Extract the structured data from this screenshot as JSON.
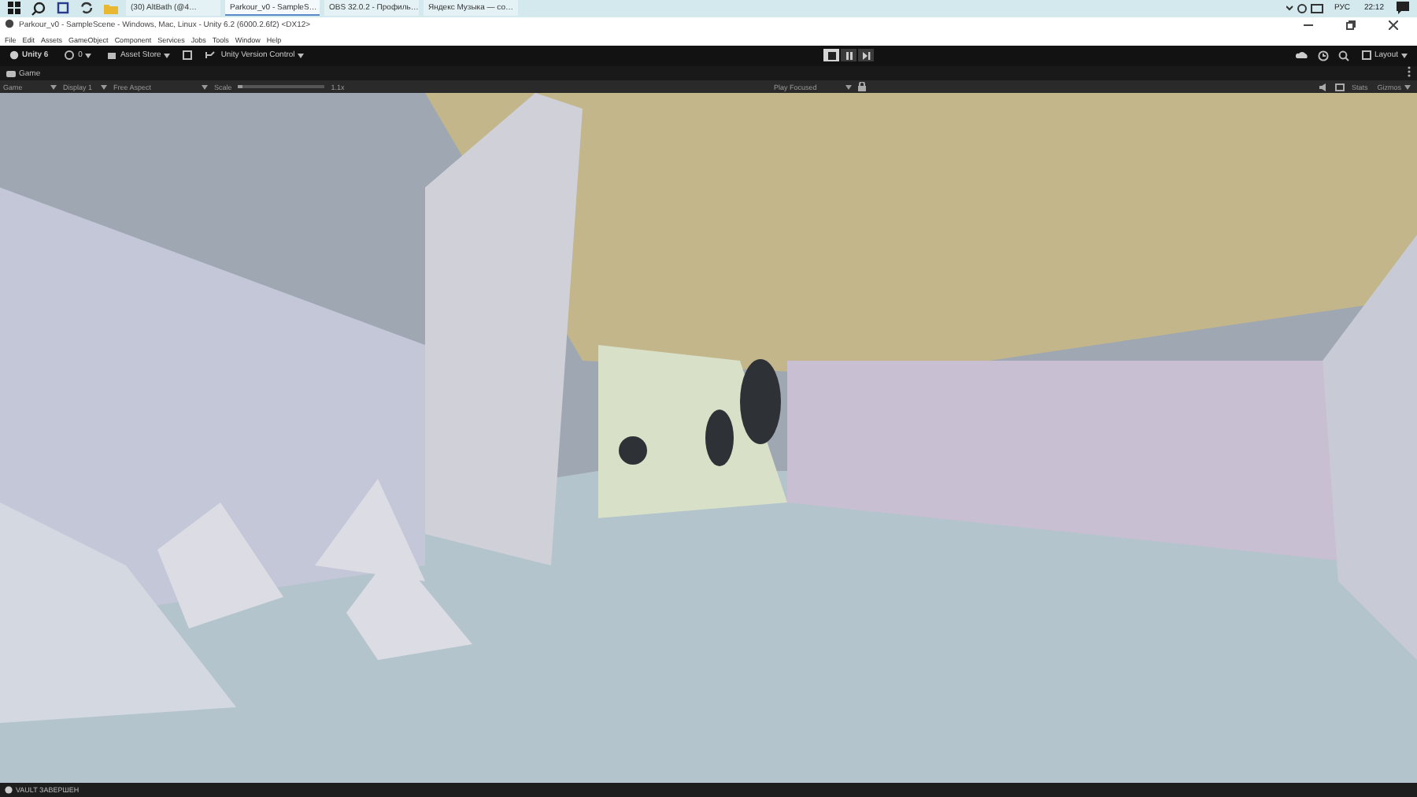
{
  "taskbar": {
    "tabs": [
      {
        "label": "(30) AltBath (@4…",
        "selected": false
      },
      {
        "label": "Parkour_v0 - SampleS…",
        "selected": true
      },
      {
        "label": "OBS 32.0.2 - Профиль…",
        "selected": false
      },
      {
        "label": "Яндекс Музыка — со…",
        "selected": false
      }
    ],
    "language": "РУС",
    "time": "22:12"
  },
  "window": {
    "title": "Parkour_v0 - SampleScene - Windows, Mac, Linux - Unity 6.2 (6000.2.6f2) <DX12>"
  },
  "menu": [
    "File",
    "Edit",
    "Assets",
    "GameObject",
    "Component",
    "Services",
    "Jobs",
    "Tools",
    "Window",
    "Help"
  ],
  "toolbar": {
    "account": "Unity 6",
    "cloud_count": "0",
    "asset_store": "Asset Store",
    "version_control": "Unity Version Control",
    "play_buttons": [
      {
        "kind": "play",
        "selected": true
      },
      {
        "kind": "pause",
        "selected": false
      },
      {
        "kind": "step",
        "selected": false
      }
    ],
    "layout": "Layout"
  },
  "tab": {
    "label": "Game"
  },
  "game_bar": {
    "mode": "Game",
    "display": "Display 1",
    "aspect": "Free Aspect",
    "scale": {
      "label": "Scale",
      "level": 0.05,
      "value": "1.1x"
    },
    "play_mode": "Play Focused",
    "stats": "Stats",
    "gizmos": "Gizmos"
  },
  "status_bar": {
    "message": "VAULT ЗАВЕРШЕН"
  }
}
